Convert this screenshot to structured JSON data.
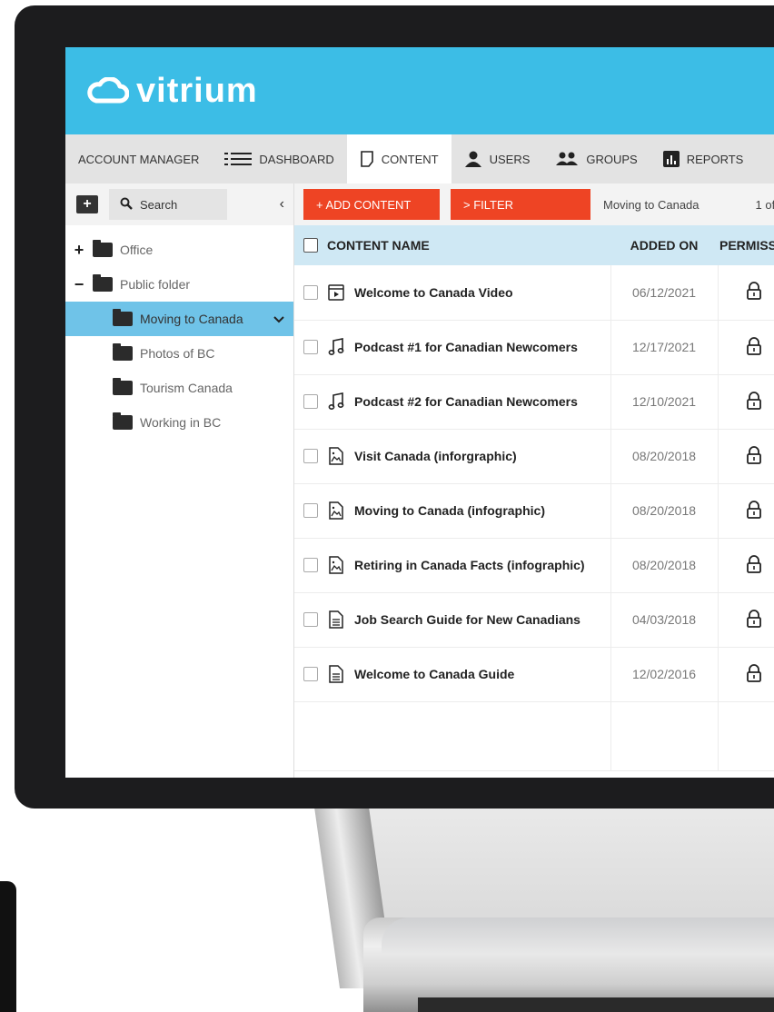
{
  "app": {
    "brand": "vitrium",
    "accent": "#3cbde6",
    "action_color": "#ee4424",
    "selected_color": "#6fc3e8"
  },
  "nav": {
    "items": [
      {
        "label": "ACCOUNT MANAGER",
        "icon": ""
      },
      {
        "label": "DASHBOARD",
        "icon": "list-icon"
      },
      {
        "label": "CONTENT",
        "icon": "document-icon",
        "active": true
      },
      {
        "label": "USERS",
        "icon": "user-icon"
      },
      {
        "label": "GROUPS",
        "icon": "group-icon"
      },
      {
        "label": "REPORTS",
        "icon": "chart-icon"
      }
    ]
  },
  "sidebar": {
    "search_label": "Search",
    "tree": [
      {
        "label": "Office",
        "toggle": "+",
        "level": 0
      },
      {
        "label": "Public folder",
        "toggle": "−",
        "level": 0
      },
      {
        "label": "Moving to Canada",
        "level": 1,
        "selected": true
      },
      {
        "label": "Photos of BC",
        "level": 1
      },
      {
        "label": "Tourism Canada",
        "level": 1
      },
      {
        "label": "Working in BC",
        "level": 1
      }
    ]
  },
  "toolbar": {
    "add_label": "+ ADD CONTENT",
    "filter_label": "> FILTER",
    "breadcrumb": "Moving to Canada",
    "page_count": "1 of"
  },
  "table": {
    "headers": {
      "name": "CONTENT NAME",
      "date": "ADDED ON",
      "perm": "PERMISSI"
    },
    "rows": [
      {
        "name": "Welcome to Canada Video",
        "date": "06/12/2021",
        "type": "video-icon"
      },
      {
        "name": "Podcast #1 for Canadian Newcomers",
        "date": "12/17/2021",
        "type": "music-icon"
      },
      {
        "name": "Podcast #2 for Canadian Newcomers",
        "date": "12/10/2021",
        "type": "music-icon"
      },
      {
        "name": "Visit Canada (inforgraphic)",
        "date": "08/20/2018",
        "type": "image-file-icon"
      },
      {
        "name": "Moving to Canada (infographic)",
        "date": "08/20/2018",
        "type": "image-file-icon"
      },
      {
        "name": "Retiring in Canada Facts (infographic)",
        "date": "08/20/2018",
        "type": "image-file-icon"
      },
      {
        "name": "Job Search Guide for New Canadians",
        "date": "04/03/2018",
        "type": "text-file-icon"
      },
      {
        "name": "Welcome to Canada Guide",
        "date": "12/02/2016",
        "type": "text-file-icon"
      }
    ]
  }
}
